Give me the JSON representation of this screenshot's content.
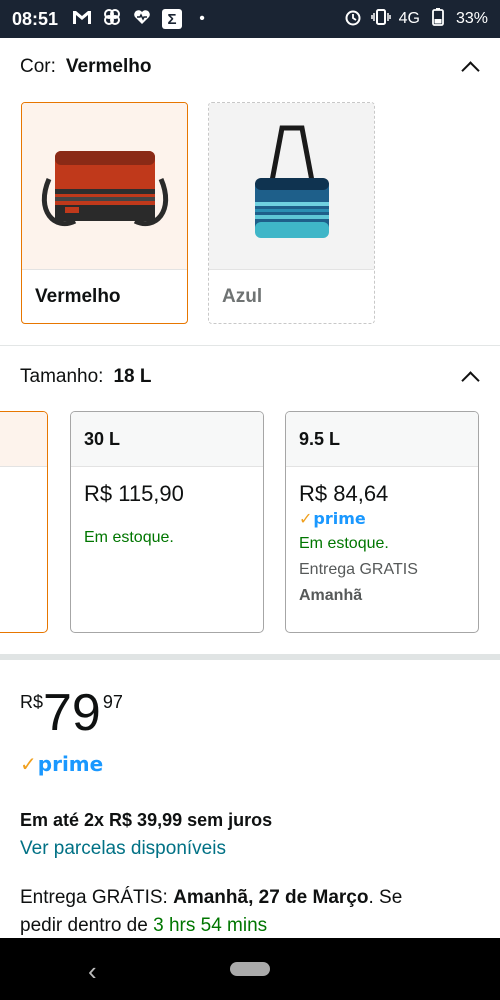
{
  "status": {
    "time": "08:51",
    "network": "4G",
    "battery": "33%"
  },
  "color": {
    "label": "Cor:",
    "value": "Vermelho",
    "options": [
      {
        "name": "Vermelho"
      },
      {
        "name": "Azul"
      }
    ]
  },
  "size": {
    "label": "Tamanho:",
    "value": "18 L",
    "options": [
      {
        "name": "30 L",
        "price": "R$ 115,90",
        "stock": "Em estoque."
      },
      {
        "name": "9.5 L",
        "price": "R$ 84,64",
        "prime": "prime",
        "stock": "Em estoque.",
        "shipping": "Entrega GRATIS",
        "when": "Amanhã"
      }
    ]
  },
  "price": {
    "currency": "R$",
    "whole": "79",
    "cents": "97",
    "prime": "prime"
  },
  "installments": {
    "text": "Em até 2x R$ 39,99 sem juros",
    "link": "Ver parcelas disponíveis"
  },
  "delivery": {
    "prefix": "Entrega GRÁTIS:",
    "date": "Amanhã, 27 de Março",
    "suffix": ". Se",
    "line2_prefix": "pedir dentro de",
    "countdown": "3 hrs 54 mins"
  },
  "colors": {
    "accent": "#e77600",
    "link": "#007185",
    "stock": "#007600",
    "prime_blue": "#1a98ff"
  }
}
